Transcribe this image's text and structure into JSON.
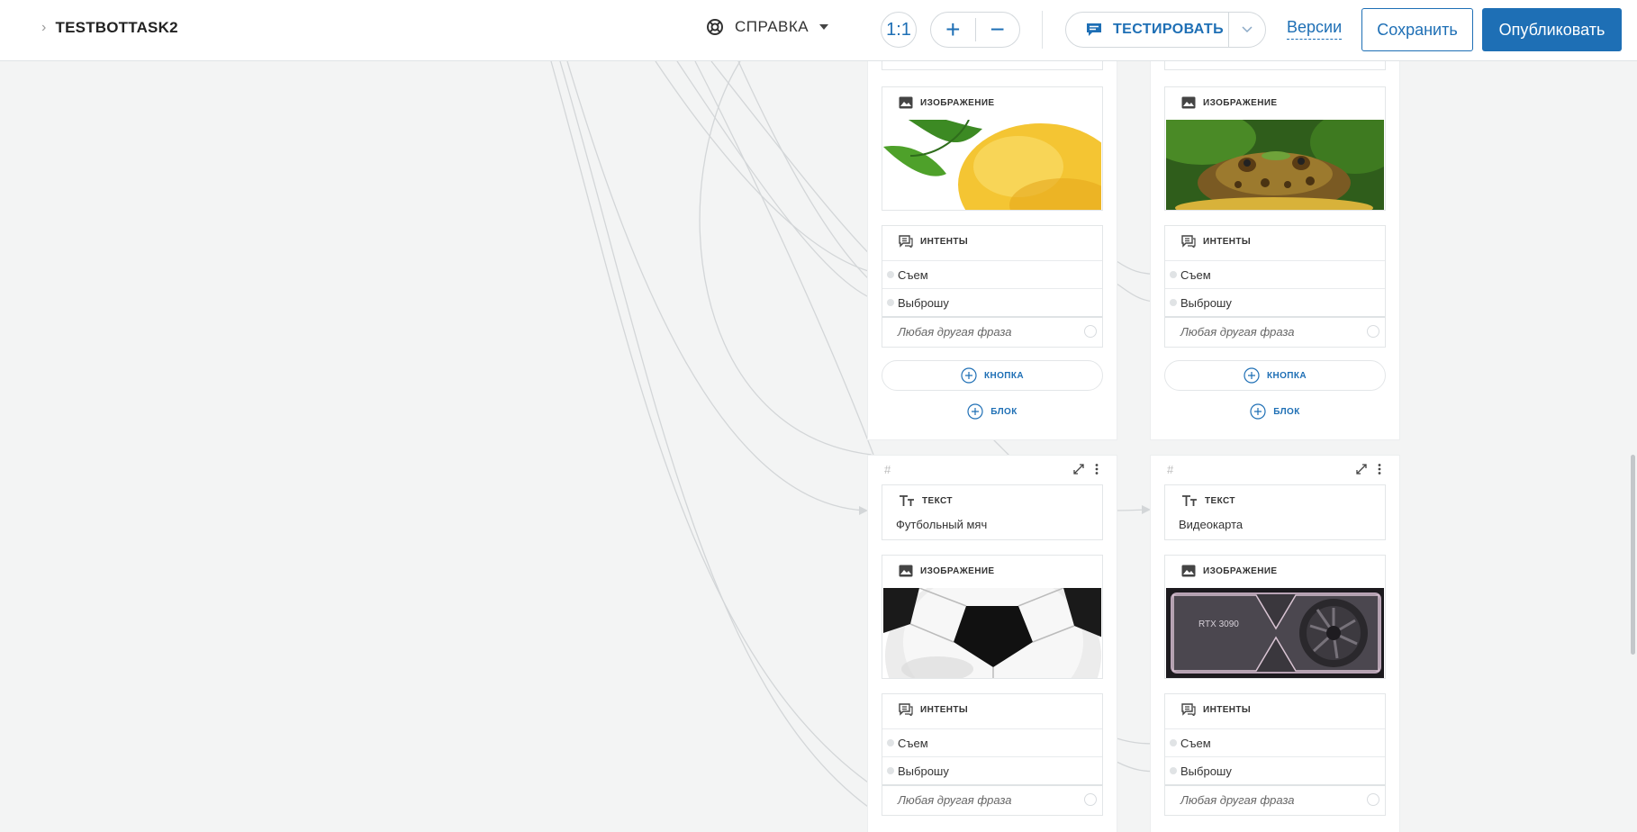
{
  "header": {
    "bot_name": "TESTBOTTASK2",
    "help_label": "СПРАВКА",
    "zoom_reset": "1:1",
    "zoom_in": "+",
    "zoom_out": "−",
    "test_label": "ТЕСТИРОВАТЬ",
    "versions_label": "Версии",
    "save_label": "Сохранить",
    "publish_label": "Опубликовать"
  },
  "labels": {
    "image": "ИЗОБРАЖЕНИЕ",
    "intents": "ИНТЕНТЫ",
    "text": "ТЕКСТ",
    "add_button": "КНОПКА",
    "add_block": "БЛОК",
    "hash": "#"
  },
  "blocks": [
    {
      "image_subject": "lemon",
      "intents": [
        "Съем",
        "Выброшу"
      ],
      "other_phrase": "Любая другая фраза"
    },
    {
      "image_subject": "frog",
      "intents": [
        "Съем",
        "Выброшу"
      ],
      "other_phrase": "Любая другая фраза"
    },
    {
      "text": "Футбольный мяч",
      "image_subject": "soccer-ball",
      "intents": [
        "Съем",
        "Выброшу"
      ],
      "other_phrase": "Любая другая фраза"
    },
    {
      "text": "Видеокарта",
      "image_subject": "graphics-card",
      "image_caption": "RTX 3090",
      "intents": [
        "Съем",
        "Выброшу"
      ],
      "other_phrase": "Любая другая фраза"
    }
  ],
  "colors": {
    "accent": "#1e6fb5",
    "canvas": "#f3f4f4",
    "connector": "#d2d5d7"
  }
}
